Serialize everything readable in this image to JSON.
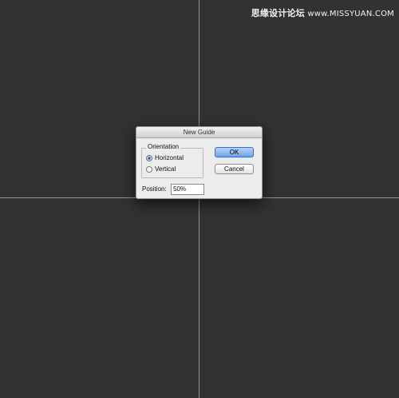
{
  "colors": {
    "canvas": "#323232",
    "guide": "#3fb7c9",
    "default_button": "#6fa4ea"
  },
  "watermark": {
    "cn": "思缘设计论坛",
    "url": "www.MISSYUAN.COM"
  },
  "dialog": {
    "title": "New Guide",
    "orientation": {
      "label": "Orientation",
      "options": [
        {
          "label": "Horizontal",
          "selected": true
        },
        {
          "label": "Vertical",
          "selected": false
        }
      ]
    },
    "ok_label": "OK",
    "cancel_label": "Cancel",
    "position_label": "Position:",
    "position_value": "50%"
  }
}
